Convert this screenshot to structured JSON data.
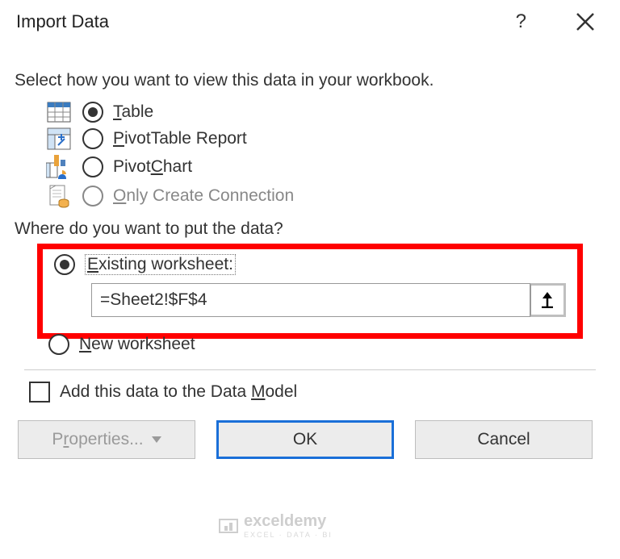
{
  "title": "Import Data",
  "help_symbol": "?",
  "prompt_view": "Select how you want to view this data in your workbook.",
  "view_options": [
    {
      "label": "Table",
      "accel_html": "<span class='u'>T</span>able",
      "selected": true,
      "icon": "table-icon"
    },
    {
      "label": "PivotTable Report",
      "accel_html": "<span class='u'>P</span>ivotTable Report",
      "selected": false,
      "icon": "pivottable-icon"
    },
    {
      "label": "PivotChart",
      "accel_html": "Pivot<span class='u'>C</span>hart",
      "selected": false,
      "icon": "pivotchart-icon"
    },
    {
      "label": "Only Create Connection",
      "accel_html": "<span class='u'>O</span>nly Create Connection",
      "selected": false,
      "icon": "connection-icon"
    }
  ],
  "prompt_location": "Where do you want to put the data?",
  "location": {
    "existing_label": "Existing worksheet:",
    "existing_accel_html": "<span class='u'>E</span>xisting worksheet:",
    "existing_selected": true,
    "reference_value": "=Sheet2!$F$4",
    "new_label": "New worksheet",
    "new_accel_html": "<span class='u'>N</span>ew worksheet",
    "new_selected": false
  },
  "data_model": {
    "label": "Add this data to the Data Model",
    "accel_html": "Add this data to the Data <span class='u'>M</span>odel",
    "checked": false
  },
  "buttons": {
    "properties": "Properties...",
    "properties_accel_html": "P<span class='u'>r</span>operties...",
    "ok": "OK",
    "cancel": "Cancel"
  },
  "watermark": {
    "brand": "exceldemy",
    "sub": "EXCEL · DATA · BI"
  }
}
